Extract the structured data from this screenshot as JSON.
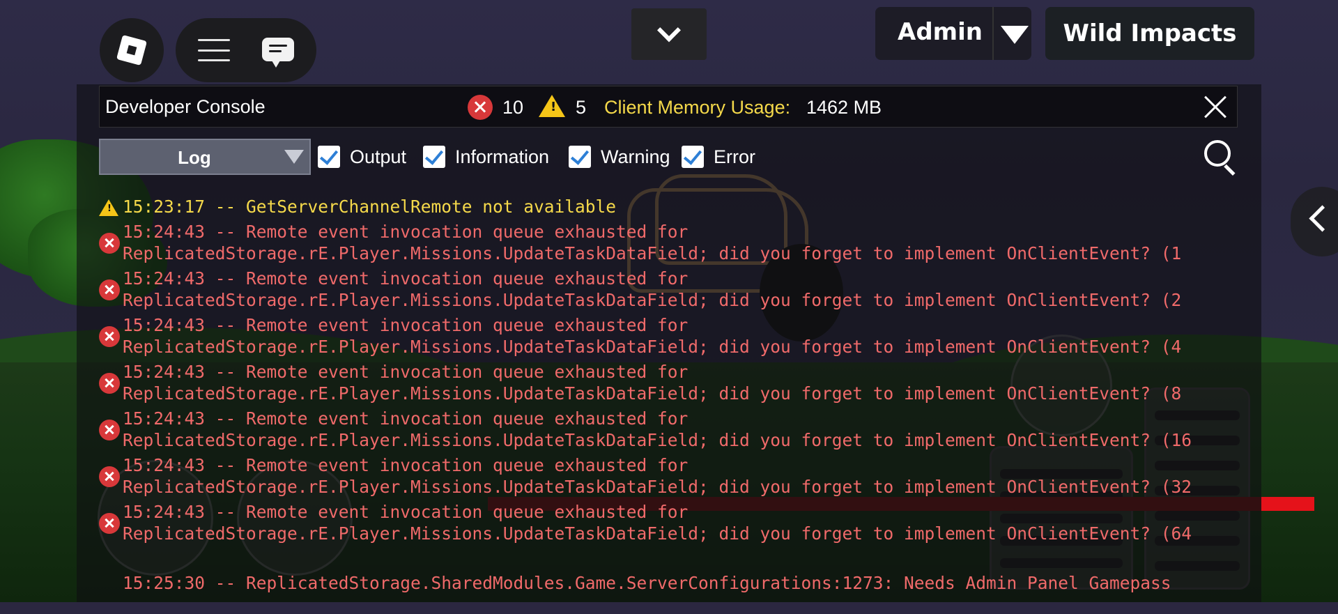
{
  "topbar": {
    "roblox_icon": "roblox-logo-icon",
    "menu_icon": "hamburger-icon",
    "chat_icon": "chat-icon",
    "collapse_icon": "chevron-down-icon",
    "team_label": "Admin",
    "team_dropdown_icon": "caret-down-icon",
    "player_name": "Wild Impacts"
  },
  "console": {
    "title": "Developer Console",
    "error_count": "10",
    "warning_count": "5",
    "memory_label": "Client Memory Usage:",
    "memory_value": "1462 MB",
    "close_icon": "close-icon",
    "view_select": "Log",
    "filters": [
      {
        "label": "Output",
        "checked": true
      },
      {
        "label": "Information",
        "checked": true
      },
      {
        "label": "Warning",
        "checked": true
      },
      {
        "label": "Error",
        "checked": true
      }
    ],
    "search_icon": "search-icon",
    "colors": {
      "warning": "#f5d94a",
      "error": "#f06a6a",
      "error_badge": "#d8383a",
      "warning_badge": "#f5c518"
    },
    "entries": [
      {
        "type": "warning",
        "lines": [
          "15:23:17 -- GetServerChannelRemote not available"
        ]
      },
      {
        "type": "error",
        "lines": [
          "15:24:43 -- Remote event invocation queue exhausted for",
          "ReplicatedStorage.rE.Player.Missions.UpdateTaskDataField; did you forget to implement OnClientEvent? (1"
        ]
      },
      {
        "type": "error",
        "lines": [
          "15:24:43 -- Remote event invocation queue exhausted for",
          "ReplicatedStorage.rE.Player.Missions.UpdateTaskDataField; did you forget to implement OnClientEvent? (2"
        ]
      },
      {
        "type": "error",
        "lines": [
          "15:24:43 -- Remote event invocation queue exhausted for",
          "ReplicatedStorage.rE.Player.Missions.UpdateTaskDataField; did you forget to implement OnClientEvent? (4"
        ]
      },
      {
        "type": "error",
        "lines": [
          "15:24:43 -- Remote event invocation queue exhausted for",
          "ReplicatedStorage.rE.Player.Missions.UpdateTaskDataField; did you forget to implement OnClientEvent? (8"
        ]
      },
      {
        "type": "error",
        "lines": [
          "15:24:43 -- Remote event invocation queue exhausted for",
          "ReplicatedStorage.rE.Player.Missions.UpdateTaskDataField; did you forget to implement OnClientEvent? (16"
        ]
      },
      {
        "type": "error",
        "lines": [
          "15:24:43 -- Remote event invocation queue exhausted for",
          "ReplicatedStorage.rE.Player.Missions.UpdateTaskDataField; did you forget to implement OnClientEvent? (32"
        ]
      },
      {
        "type": "error",
        "lines": [
          "15:24:43 -- Remote event invocation queue exhausted for",
          "ReplicatedStorage.rE.Player.Missions.UpdateTaskDataField; did you forget to implement OnClientEvent? (64"
        ]
      },
      {
        "type": "error",
        "lines": [
          "15:25:30 -- ReplicatedStorage.SharedModules.Game.ServerConfigurations:1273: Needs Admin Panel Gamepass"
        ]
      }
    ]
  }
}
